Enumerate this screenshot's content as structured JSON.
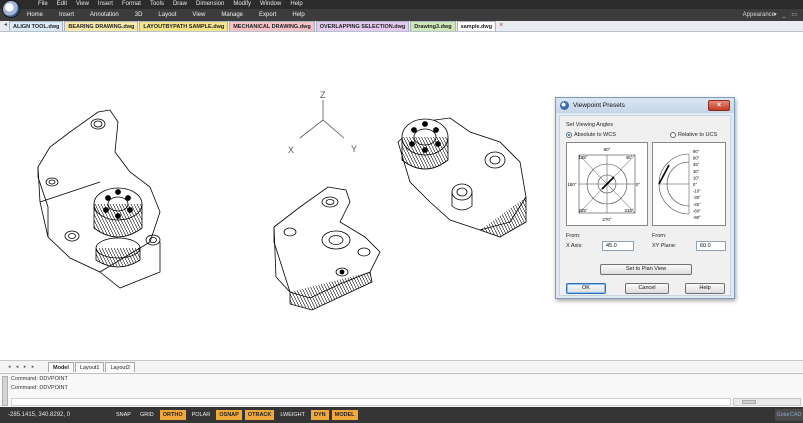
{
  "menu": [
    "File",
    "Edit",
    "View",
    "Insert",
    "Format",
    "Tools",
    "Draw",
    "Dimension",
    "Modify",
    "Window",
    "Help"
  ],
  "ribbon": {
    "tabs": [
      "Home",
      "Insert",
      "Annotation",
      "3D",
      "Layout",
      "View",
      "Manage",
      "Export",
      "Help"
    ],
    "appearance": "Appearance",
    "window_controls": "▾ _ ▭"
  },
  "doc_tabs": {
    "arrow": "◂",
    "items": [
      {
        "label": "ALIGN TOOL.dwg",
        "color": "#dbe9f7"
      },
      {
        "label": "BEARING DRAWING.dwg",
        "color": "#f8e7a7"
      },
      {
        "label": "LAYOUTBYPATH SAMPLE.dwg",
        "color": "#f3e38a"
      },
      {
        "label": "MECHANICAL DRAWING.dwg",
        "color": "#f6c1c7"
      },
      {
        "label": "OVERLAPPING SELECTION.dwg",
        "color": "#e4c9f0"
      },
      {
        "label": "Drawing3.dwg",
        "color": "#cfe8b8"
      },
      {
        "label": "sample.dwg",
        "color": "#ffffff"
      }
    ],
    "close": "×"
  },
  "axis_labels": {
    "z": "Z",
    "x": "X",
    "y": "Y"
  },
  "dialog": {
    "title": "Viewpoint Presets",
    "close": "×",
    "section_label": "Set Viewing Angles",
    "radio_absolute": "Absolute to WCS",
    "radio_relative": "Relative to UCS",
    "angles_left": [
      "90°",
      "135°",
      "45°",
      "180°",
      "0°",
      "225°",
      "315°",
      "270°"
    ],
    "angles_right": [
      "90°",
      "60°",
      "45°",
      "30°",
      "10°",
      "0°",
      "-10°",
      "-30°",
      "-45°",
      "-60°",
      "-90°"
    ],
    "from_x_label": "From:",
    "x_axis_label": "X Axis:",
    "x_axis_value": "45.0",
    "from_xy_label": "From:",
    "xy_plane_label": "XY Plane:",
    "xy_plane_value": "60.0",
    "plan_view": "Set to Plan View",
    "ok": "OK",
    "cancel": "Cancel",
    "help": "Help"
  },
  "layout_tabs": {
    "nav": "◂ ◂ ▸ ▸",
    "items": [
      "Model",
      "Layout1",
      "Layout2"
    ]
  },
  "command": {
    "line1": "Command: DDVPOINT",
    "line2": "Command: DDVPOINT"
  },
  "status": {
    "coords": "-285.1415, 340.8292, 0",
    "buttons": [
      {
        "label": "SNAP",
        "on": false
      },
      {
        "label": "GRID",
        "on": false
      },
      {
        "label": "ORTHO",
        "on": true
      },
      {
        "label": "POLAR",
        "on": false
      },
      {
        "label": "OSNAP",
        "on": true
      },
      {
        "label": "OTRACK",
        "on": true
      },
      {
        "label": "LWEIGHT",
        "on": false
      },
      {
        "label": "DYN",
        "on": true
      },
      {
        "label": "MODEL",
        "on": true
      }
    ],
    "right": "GstarCAD"
  }
}
